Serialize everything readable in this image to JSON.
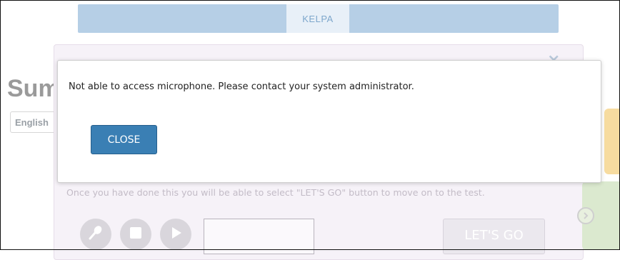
{
  "header": {
    "tab_label": "KELPA"
  },
  "background": {
    "heading": "Sum",
    "language_select": "English",
    "instruction": "Once you have done this you will be able to select \"LET'S GO\" button to move on to the test.",
    "lets_go_label": "LET'S GO",
    "close_glyph": "×"
  },
  "modal": {
    "message": "Not able to access microphone. Please contact your system administrator.",
    "close_label": "CLOSE"
  },
  "icons": [
    "microphone-icon",
    "stop-icon",
    "play-icon",
    "next-arrow-icon",
    "close-icon"
  ],
  "colors": {
    "accent": "#3a7fb4",
    "header_bar": "#b6cfe6",
    "panel_bg": "#f6f2f8"
  }
}
